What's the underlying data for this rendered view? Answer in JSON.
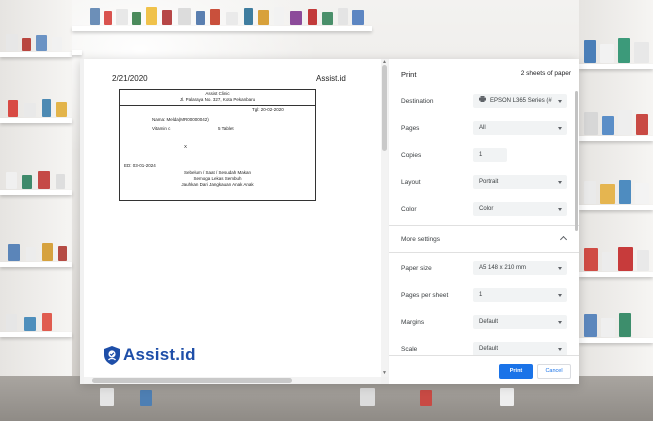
{
  "preview": {
    "date": "2/21/2020",
    "site": "Assist.id",
    "receipt": {
      "clinic_name": "Assist Clinic",
      "clinic_address": "Jl. Palaraya No. 327, Kota Pekanbaru",
      "date_line": "Tgl: 20-02-2020",
      "patient": "Nama: Melda(MR00000042)",
      "drug": "Vitamin c",
      "quantity": "5 Tablet",
      "mark": "X",
      "expiry": "ED: 03-01-2024",
      "instruction_1": "Sebelum / Saat / Sesudah Makan",
      "instruction_2": "Semoga Lekas Sembuh",
      "instruction_3": "Jauhkan Dari Jangkauan Anak Anak"
    },
    "logo_text": "Assist.id"
  },
  "settings": {
    "title": "Print",
    "sheets": "2 sheets of paper",
    "destination": {
      "label": "Destination",
      "value": "EPSON L365 Series (#"
    },
    "pages": {
      "label": "Pages",
      "value": "All"
    },
    "copies": {
      "label": "Copies",
      "value": "1"
    },
    "layout": {
      "label": "Layout",
      "value": "Portrait"
    },
    "color": {
      "label": "Color",
      "value": "Color"
    },
    "more_settings": "More settings",
    "paper_size": {
      "label": "Paper size",
      "value": "A5 148 x 210 mm"
    },
    "pages_per_sheet": {
      "label": "Pages per sheet",
      "value": "1"
    },
    "margins": {
      "label": "Margins",
      "value": "Default"
    },
    "scale": {
      "label": "Scale",
      "value": "Default"
    },
    "print_button": "Print",
    "cancel_button": "Cancel"
  },
  "colors": {
    "accent": "#1a73e8",
    "logo": "#1e4ea8"
  }
}
